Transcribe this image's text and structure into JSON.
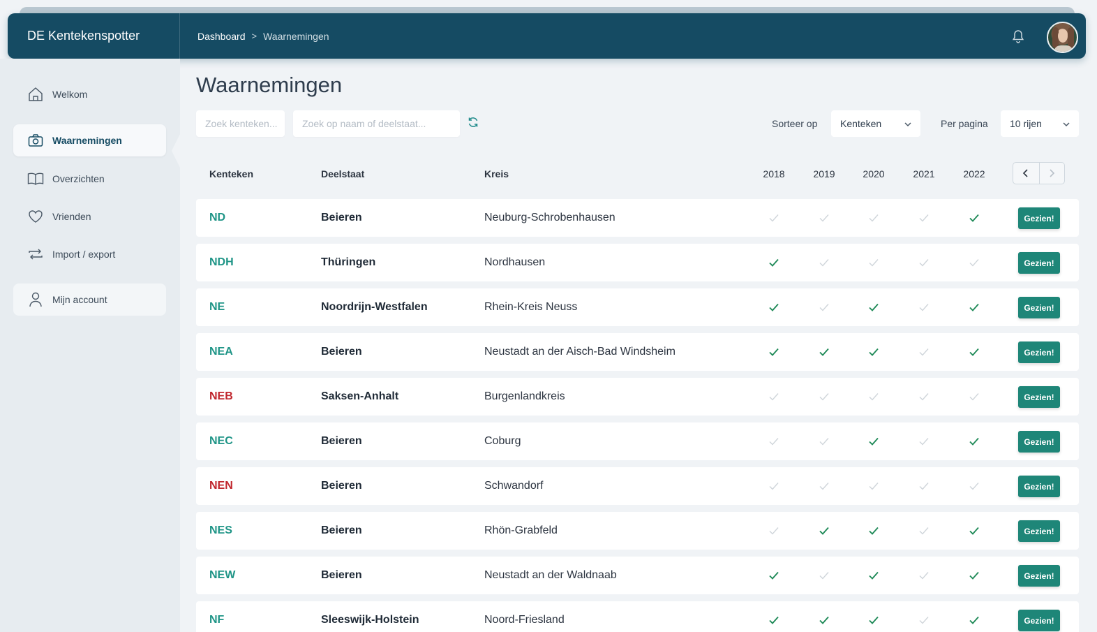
{
  "app": {
    "title": "DE Kentekenspotter"
  },
  "breadcrumb": {
    "home": "Dashboard",
    "separator": ">",
    "current": "Waarnemingen"
  },
  "header": {
    "bell_icon": "bell-icon",
    "avatar_icon": "user-avatar"
  },
  "sidebar": {
    "items": [
      {
        "label": "Welkom",
        "icon": "home-icon"
      },
      {
        "label": "Waarnemingen",
        "icon": "camera-icon",
        "active": true
      },
      {
        "label": "Overzichten",
        "icon": "book-icon"
      },
      {
        "label": "Vrienden",
        "icon": "heart-icon"
      },
      {
        "label": "Import / export",
        "icon": "arrows-exchange-icon"
      },
      {
        "label": "Mijn account",
        "icon": "user-icon"
      }
    ]
  },
  "main": {
    "title": "Waarnemingen",
    "search_plate_placeholder": "Zoek kenteken...",
    "search_name_placeholder": "Zoek op naam of deelstaat...",
    "sort_label": "Sorteer op",
    "sort_value": "Kenteken",
    "per_page_label": "Per pagina",
    "per_page_value": "10 rijen"
  },
  "table": {
    "columns": {
      "kenteken": "Kenteken",
      "deelstaat": "Deelstaat",
      "kreis": "Kreis"
    },
    "years": [
      "2018",
      "2019",
      "2020",
      "2021",
      "2022"
    ],
    "action_label": "Gezien!",
    "colors": {
      "seen_check": "#1f8a58",
      "unseen_check": "#cfd5da",
      "code_default": "#1e9486",
      "code_alert": "#c0262d"
    },
    "rows": [
      {
        "code": "ND",
        "alert": false,
        "state": "Beieren",
        "kreis": "Neuburg-Schrobenhausen",
        "seen": [
          0,
          0,
          0,
          0,
          1
        ]
      },
      {
        "code": "NDH",
        "alert": false,
        "state": "Thüringen",
        "kreis": "Nordhausen",
        "seen": [
          1,
          0,
          0,
          0,
          0
        ]
      },
      {
        "code": "NE",
        "alert": false,
        "state": "Noordrijn-Westfalen",
        "kreis": "Rhein-Kreis Neuss",
        "seen": [
          1,
          0,
          1,
          0,
          1
        ]
      },
      {
        "code": "NEA",
        "alert": false,
        "state": "Beieren",
        "kreis": "Neustadt an der Aisch-Bad Windsheim",
        "seen": [
          1,
          1,
          1,
          0,
          1
        ]
      },
      {
        "code": "NEB",
        "alert": true,
        "state": "Saksen-Anhalt",
        "kreis": "Burgenlandkreis",
        "seen": [
          0,
          0,
          0,
          0,
          0
        ]
      },
      {
        "code": "NEC",
        "alert": false,
        "state": "Beieren",
        "kreis": "Coburg",
        "seen": [
          0,
          0,
          1,
          0,
          1
        ]
      },
      {
        "code": "NEN",
        "alert": true,
        "state": "Beieren",
        "kreis": "Schwandorf",
        "seen": [
          0,
          0,
          0,
          0,
          0
        ]
      },
      {
        "code": "NES",
        "alert": false,
        "state": "Beieren",
        "kreis": "Rhön-Grabfeld",
        "seen": [
          0,
          1,
          1,
          0,
          1
        ]
      },
      {
        "code": "NEW",
        "alert": false,
        "state": "Beieren",
        "kreis": "Neustadt an der Waldnaab",
        "seen": [
          1,
          0,
          1,
          0,
          1
        ]
      },
      {
        "code": "NF",
        "alert": false,
        "state": "Sleeswijk-Holstein",
        "kreis": "Noord-Friesland",
        "seen": [
          1,
          1,
          1,
          0,
          1
        ]
      }
    ]
  }
}
